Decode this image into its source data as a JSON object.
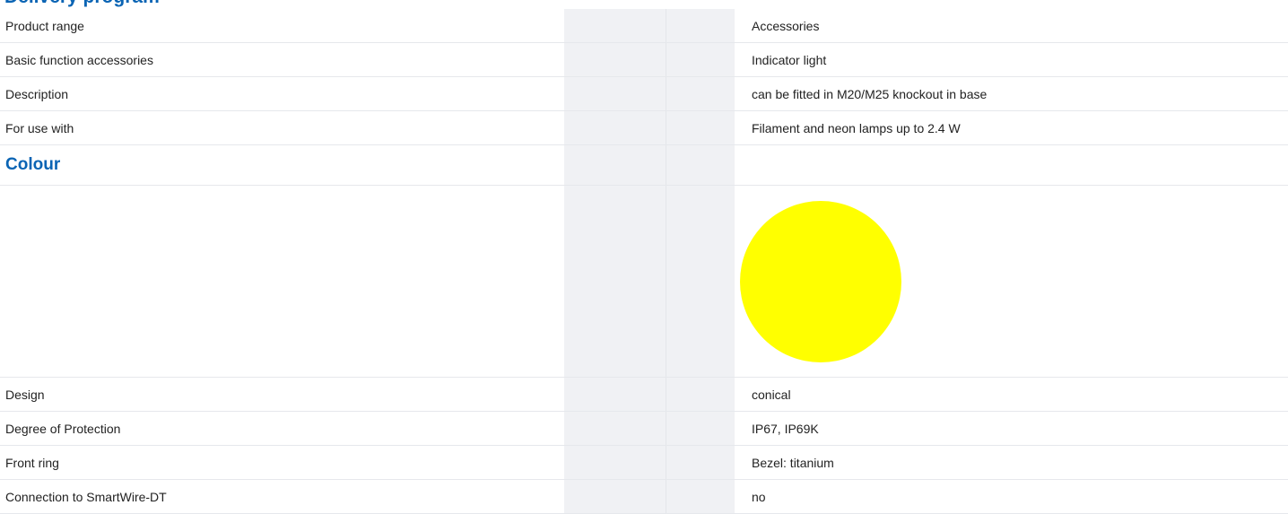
{
  "section_title_cut": "Delivery program",
  "rows_top": [
    {
      "label": "Product range",
      "value": "Accessories"
    },
    {
      "label": "Basic function accessories",
      "value": "Indicator light"
    },
    {
      "label": "Description",
      "value": "can be fitted in M20/M25 knockout in base"
    },
    {
      "label": "For use with",
      "value": "Filament and neon lamps up to 2.4 W"
    }
  ],
  "colour_section": {
    "heading": "Colour",
    "swatch_color": "#ffff00"
  },
  "rows_bottom": [
    {
      "label": "Design",
      "value": "conical"
    },
    {
      "label": "Degree of Protection",
      "value": "IP67, IP69K"
    },
    {
      "label": "Front ring",
      "value": "Bezel: titanium"
    },
    {
      "label": "Connection to SmartWire-DT",
      "value": "no"
    }
  ],
  "colors": {
    "accent": "#0a64b4",
    "stripe": "#f0f1f4",
    "divider": "#e6e8ec"
  }
}
